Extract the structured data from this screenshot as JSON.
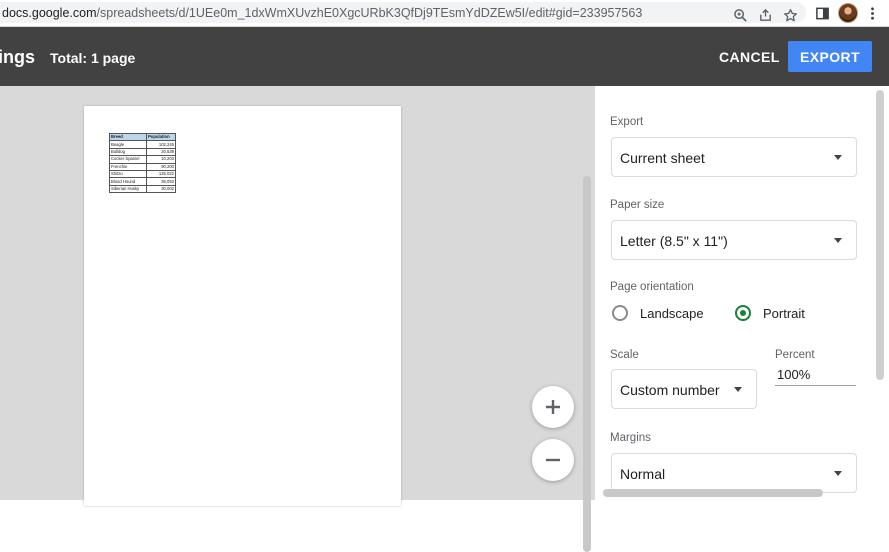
{
  "browser": {
    "url_host": "docs.google.com",
    "url_path": "/spreadsheets/d/1UEe0m_1dxWmXUvzhE0XgcURbK3QfDj9TEsmYdDZEw5I/edit#gid=233957563",
    "icons": [
      "zoom-icon",
      "share-icon",
      "star-icon",
      "side-panel-icon",
      "avatar",
      "more-vert-icon"
    ]
  },
  "header": {
    "title": "ings",
    "total": "Total: 1 page",
    "cancel_label": "CANCEL",
    "export_label": "EXPORT",
    "background": "#424242",
    "accent": "#4285f4"
  },
  "preview": {
    "table": {
      "headers": [
        "Breed",
        "Population"
      ],
      "rows": [
        [
          "Beagle",
          "102,245"
        ],
        [
          "Bulldog",
          "20,539"
        ],
        [
          "Cocker Spaniel",
          "10,203"
        ],
        [
          "Frenchie",
          "90,200"
        ],
        [
          "Shitzu",
          "125,022"
        ],
        [
          "Blood Hound",
          "35,053"
        ],
        [
          "Siberian Husky",
          "30,002"
        ]
      ]
    },
    "zoom_in_icon": "plus-icon",
    "zoom_out_icon": "minus-icon"
  },
  "settings": {
    "export_label": "Export",
    "export_value": "Current sheet",
    "paper_size_label": "Paper size",
    "paper_size_value": "Letter (8.5\" x 11\")",
    "orientation_label": "Page orientation",
    "landscape_label": "Landscape",
    "portrait_label": "Portrait",
    "orientation_selected": "Portrait",
    "scale_label": "Scale",
    "scale_value": "Custom number",
    "percent_label": "Percent",
    "percent_value": "100%",
    "margins_label": "Margins",
    "margins_value": "Normal",
    "radio_color": "#188038"
  }
}
